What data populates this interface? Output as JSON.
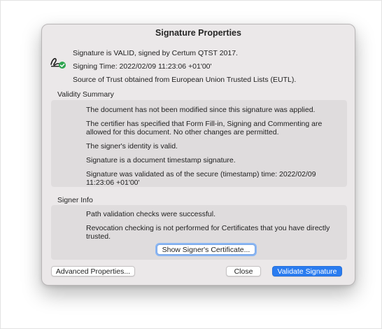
{
  "dialog": {
    "title": "Signature Properties"
  },
  "summary": {
    "status": "Signature is VALID, signed by Certum QTST 2017.",
    "signing_time": "Signing Time:  2022/02/09 11:23:06 +01'00'",
    "trust_source": "Source of Trust obtained from European Union Trusted Lists (EUTL).",
    "icon": "signature-valid-icon"
  },
  "validity": {
    "label": "Validity Summary",
    "items": [
      "The document has not been modified since this signature was applied.",
      "The certifier has specified that Form Fill-in, Signing and Commenting are allowed for this document. No other changes are permitted.",
      "The signer's identity is valid.",
      "Signature is a document timestamp signature.",
      "Signature was validated as of the secure (timestamp) time: 2022/02/09 11:23:06 +01'00'"
    ]
  },
  "signer": {
    "label": "Signer Info",
    "items": [
      "Path validation checks were successful.",
      "Revocation checking is not performed for Certificates that you have directly trusted."
    ],
    "show_certificate_label": "Show Signer's Certificate..."
  },
  "footer": {
    "advanced_label": "Advanced Properties...",
    "close_label": "Close",
    "validate_label": "Validate Signature"
  },
  "colors": {
    "accent": "#2a7cf0",
    "valid_check": "#2ea44f"
  }
}
